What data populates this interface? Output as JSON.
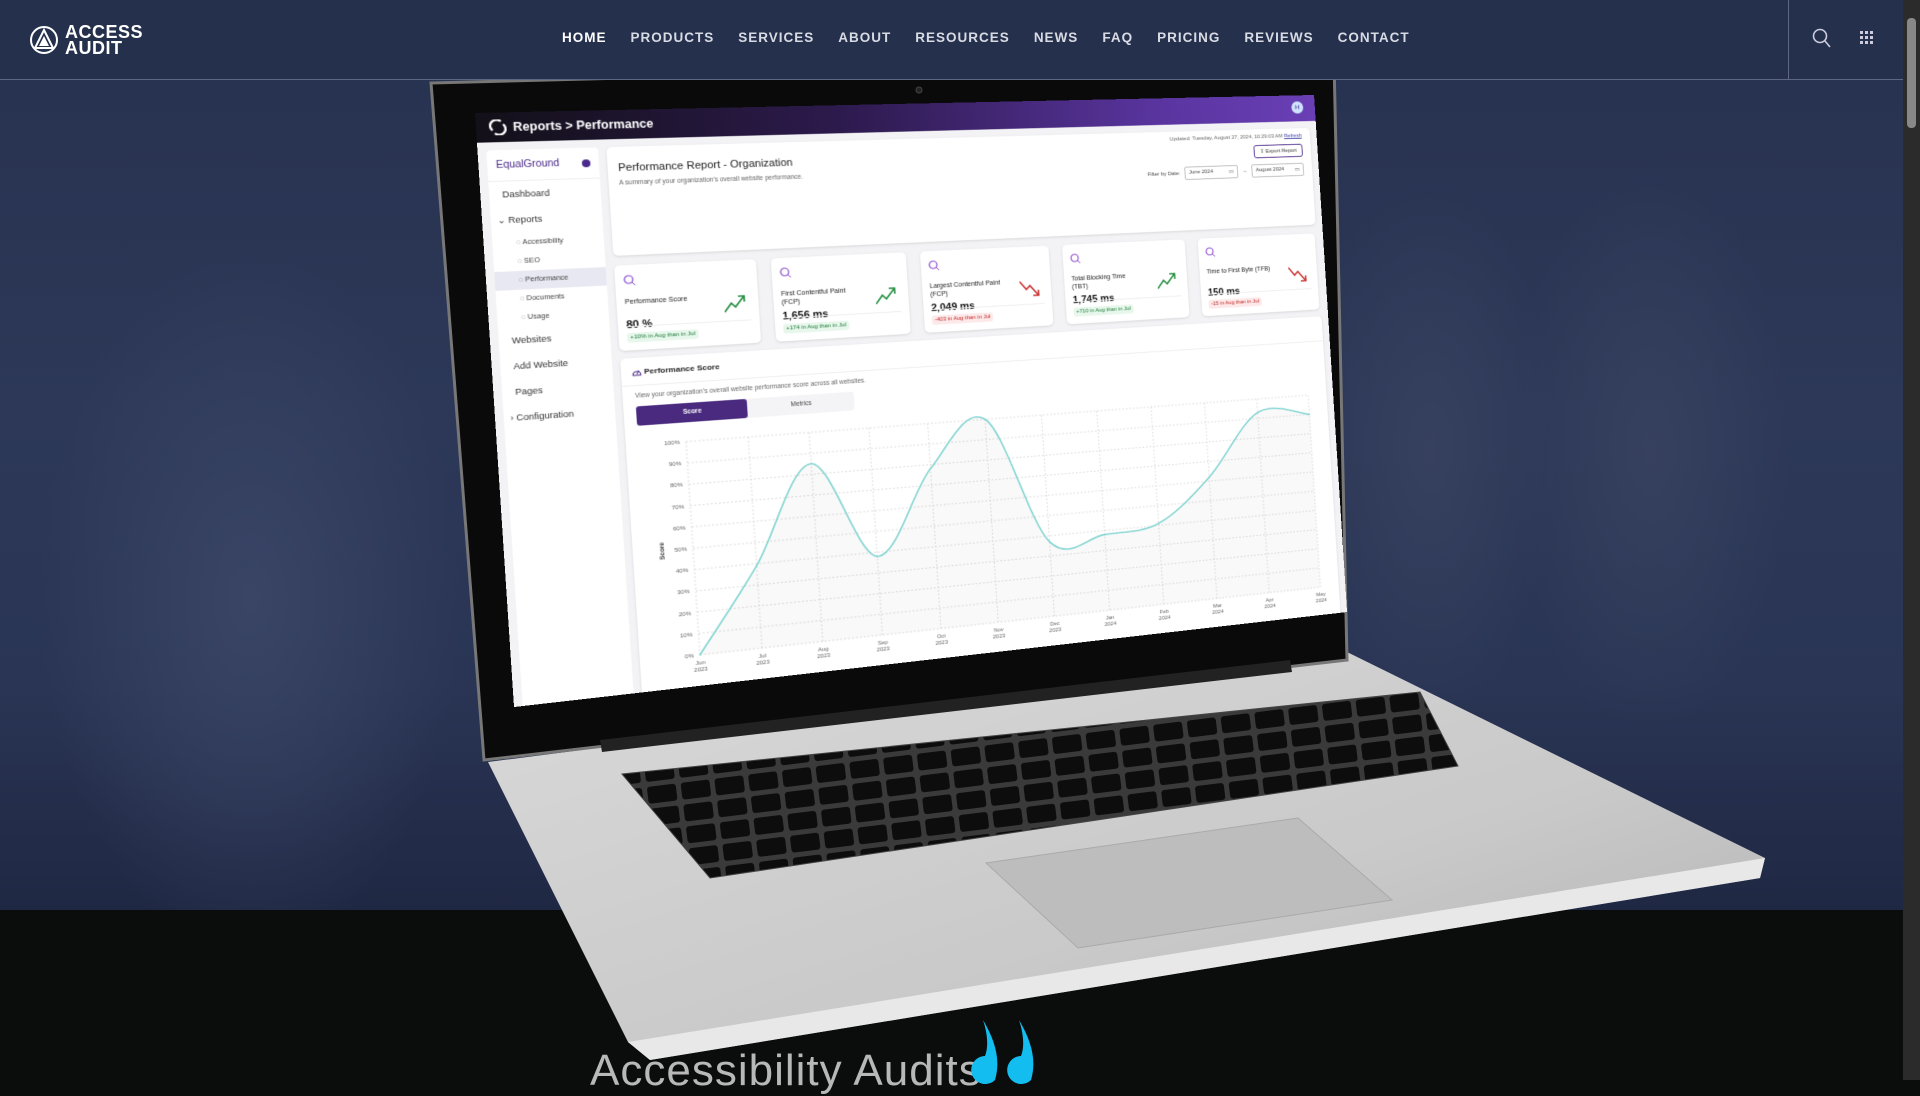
{
  "nav": {
    "brand_line1": "ACCESS",
    "brand_line2": "AUDIT",
    "items": [
      "HOME",
      "PRODUCTS",
      "SERVICES",
      "ABOUT",
      "RESOURCES",
      "NEWS",
      "FAQ",
      "PRICING",
      "REVIEWS",
      "CONTACT"
    ],
    "active": "HOME",
    "icons": [
      "search-icon",
      "grid-menu-icon"
    ]
  },
  "app": {
    "breadcrumb": "Reports > Performance",
    "avatar_initial": "H",
    "sidebar": {
      "org": "EqualGround",
      "items": [
        {
          "label": "Dashboard",
          "type": "item"
        },
        {
          "label": "Reports",
          "type": "group"
        },
        {
          "label": "Accessibility",
          "type": "sub"
        },
        {
          "label": "SEO",
          "type": "sub"
        },
        {
          "label": "Performance",
          "type": "sub",
          "active": true
        },
        {
          "label": "Documents",
          "type": "sub"
        },
        {
          "label": "Usage",
          "type": "sub"
        },
        {
          "label": "Websites",
          "type": "item"
        },
        {
          "label": "Add Website",
          "type": "item"
        },
        {
          "label": "Pages",
          "type": "item"
        },
        {
          "label": "Configuration",
          "type": "group-collapsed"
        }
      ]
    },
    "header": {
      "title": "Performance Report - Organization",
      "subtitle": "A summary of your organization's overall website performance.",
      "updated": "Updated: Tuesday, August 27, 2024, 10:29:03 AM",
      "refresh": "Refresh",
      "export": "Export Report",
      "filter_label": "Filter by Date:",
      "date_from": "June 2024",
      "date_to": "August 2024"
    },
    "stats": [
      {
        "label": "Performance Score",
        "value": "80 %",
        "change": "+10% in Aug than in Jul",
        "trend": "up"
      },
      {
        "label": "First Contentful Paint (FCP)",
        "value": "1,656 ms",
        "change": "+174 in Aug than in Jul",
        "trend": "up"
      },
      {
        "label": "Largest Contentful Paint (FCP)",
        "value": "2,049 ms",
        "change": "-403 in Aug than in Jul",
        "trend": "down"
      },
      {
        "label": "Total Blocking Time (TBT)",
        "value": "1,745 ms",
        "change": "+710 in Aug than in Jul",
        "trend": "up"
      },
      {
        "label": "Time to First Byte (TFB)",
        "value": "150 ms",
        "change": "-15 in Aug than in Jul",
        "trend": "down"
      }
    ],
    "chart_card": {
      "title": "Performance Score",
      "description": "View your organization's overall website performance score across all websites.",
      "tabs": [
        "Score",
        "Metrics"
      ],
      "active_tab": "Score"
    }
  },
  "chart_data": {
    "type": "line",
    "ylabel": "Score",
    "ylim": [
      0,
      100
    ],
    "yticks": [
      "0%",
      "10%",
      "20%",
      "30%",
      "40%",
      "50%",
      "60%",
      "70%",
      "80%",
      "90%",
      "100%"
    ],
    "categories": [
      [
        "Jun",
        "2023"
      ],
      [
        "Jul",
        "2023"
      ],
      [
        "Aug",
        "2023"
      ],
      [
        "Sep",
        "2023"
      ],
      [
        "Oct",
        "2023"
      ],
      [
        "Nov",
        "2023"
      ],
      [
        "Dec",
        "2023"
      ],
      [
        "Jan",
        "2024"
      ],
      [
        "Feb",
        "2024"
      ],
      [
        "Mar",
        "2024"
      ],
      [
        "Apr",
        "2024"
      ],
      [
        "May",
        "2024"
      ]
    ],
    "values": [
      0,
      39,
      85,
      38,
      78,
      100,
      37,
      38,
      41,
      62,
      93,
      90
    ],
    "line_color": "#7fd3d0",
    "grid": true
  },
  "bottom": {
    "heading": "Accessibility Audits"
  },
  "colors": {
    "nav_bg": "#25304c",
    "accent_purple": "#4a2a7f",
    "quote_cyan": "#14bdf0"
  }
}
